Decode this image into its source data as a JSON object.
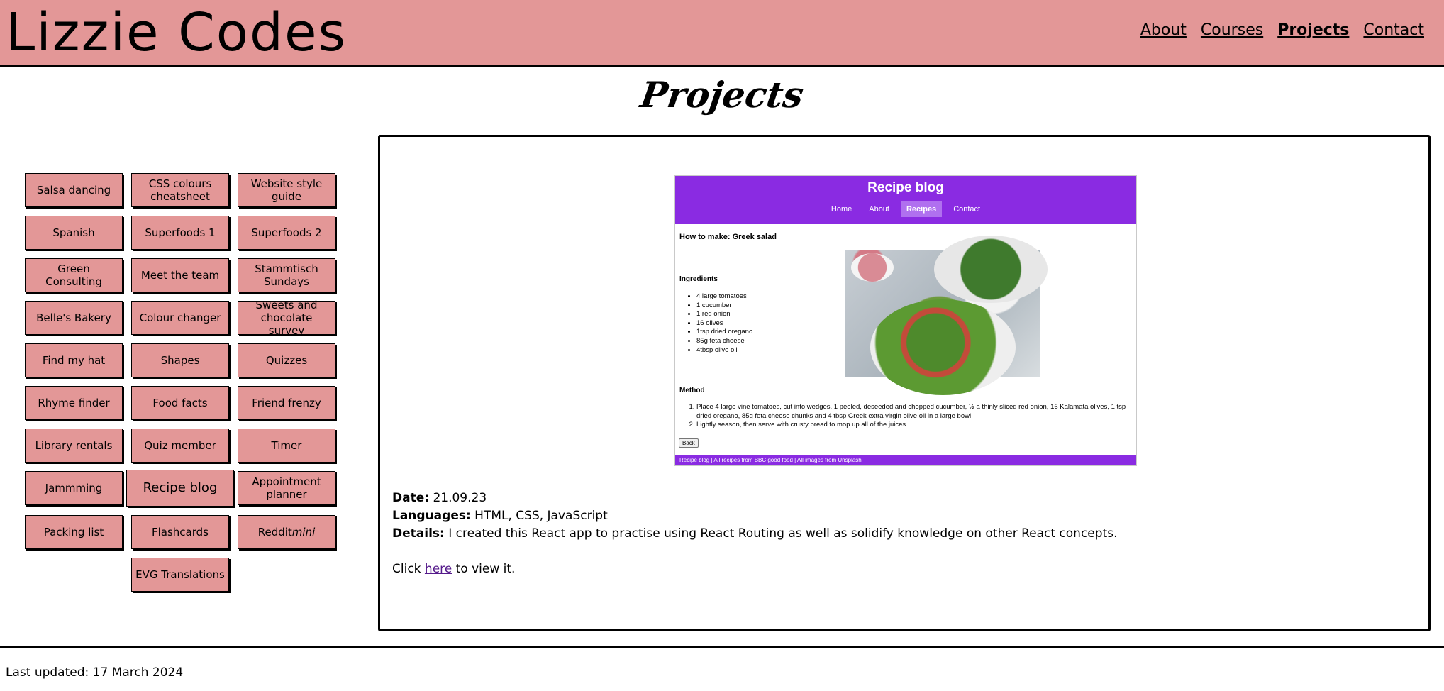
{
  "header": {
    "title": "Lizzie Codes",
    "nav": [
      "About",
      "Courses",
      "Projects",
      "Contact"
    ],
    "active_nav": "Projects",
    "bg_color": "#e39797"
  },
  "page": {
    "heading": "Projects"
  },
  "projects": [
    "Salsa dancing",
    "CSS colours cheatsheet",
    "Website style guide",
    "Spanish",
    "Superfoods 1",
    "Superfoods 2",
    "Green Consulting",
    "Meet the team",
    "Stammtisch Sundays",
    "Belle's Bakery",
    "Colour changer",
    "Sweets and chocolate survey",
    "Find my hat",
    "Shapes",
    "Quizzes",
    "Rhyme finder",
    "Food facts",
    "Friend frenzy",
    "Library rentals",
    "Quiz member",
    "Timer",
    "Jammming",
    "Recipe blog",
    "Appointment planner",
    "Packing list",
    "Flashcards",
    "Redditmini",
    "EVG Translations"
  ],
  "reddit_label": {
    "main": "Reddit",
    "italic": "mini"
  },
  "active_project": "Recipe blog",
  "preview": {
    "title": "Recipe blog",
    "nav": [
      "Home",
      "About",
      "Recipes",
      "Contact"
    ],
    "active_nav": "Recipes",
    "heading": "How to make: Greek salad",
    "ingredients_label": "Ingredients",
    "ingredients": [
      "4 large tomatoes",
      "1 cucumber",
      "1 red onion",
      "16 olives",
      "1tsp dried oregano",
      "85g feta cheese",
      "4tbsp olive oil"
    ],
    "method_label": "Method",
    "method": [
      "Place 4 large vine tomatoes, cut into wedges, 1 peeled, deseeded and chopped cucumber, ½ a thinly sliced red onion, 16 Kalamata olives, 1 tsp dried oregano, 85g feta cheese chunks and 4 tbsp Greek extra virgin olive oil in a large bowl.",
      "Lightly season, then serve with crusty bread to mop up all of the juices."
    ],
    "back_label": "Back",
    "footer": {
      "prefix": "Recipe blog | All recipes from ",
      "link1": "BBC good food",
      "middle": " | All images from ",
      "link2": "Unsplash"
    },
    "accent_color": "#8a2be2"
  },
  "details": {
    "date_label": "Date:",
    "date": "21.09.23",
    "languages_label": "Languages:",
    "languages": "HTML, CSS, JavaScript",
    "details_label": "Details:",
    "details": "I created this React app to practise using React Routing as well as solidify knowledge on other React concepts.",
    "click_prefix": "Click ",
    "click_link": "here",
    "click_suffix": " to view it."
  },
  "footer": {
    "updated": "Last updated: 17 March 2024"
  }
}
